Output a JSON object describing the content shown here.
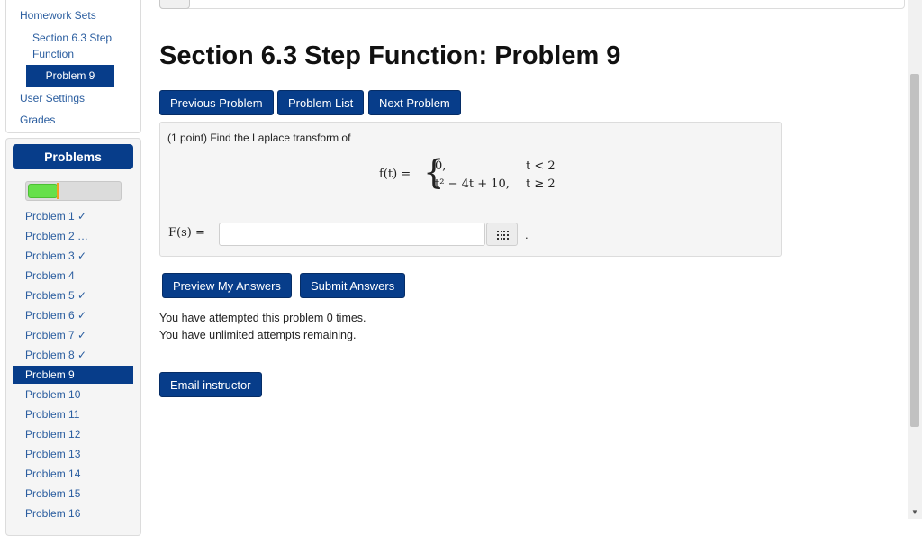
{
  "nav": {
    "homework_sets": "Homework Sets",
    "set_link_line1": "Section 6.3 Step",
    "set_link_line2": "Function",
    "current_problem": "Problem 9",
    "user_settings": "User Settings",
    "grades": "Grades"
  },
  "problems_panel": {
    "header": "Problems",
    "progress_fraction": 0.33,
    "items": [
      {
        "label": "Problem 1 ✓"
      },
      {
        "label": "Problem 2 …"
      },
      {
        "label": "Problem 3 ✓"
      },
      {
        "label": "Problem 4"
      },
      {
        "label": "Problem 5 ✓"
      },
      {
        "label": "Problem 6 ✓"
      },
      {
        "label": "Problem 7 ✓"
      },
      {
        "label": "Problem 8 ✓"
      },
      {
        "label": "Problem 9",
        "current": true
      },
      {
        "label": "Problem 10"
      },
      {
        "label": "Problem 11"
      },
      {
        "label": "Problem 12"
      },
      {
        "label": "Problem 13"
      },
      {
        "label": "Problem 14"
      },
      {
        "label": "Problem 15"
      },
      {
        "label": "Problem 16"
      }
    ]
  },
  "main": {
    "title": "Section 6.3 Step Function: Problem 9",
    "buttons": {
      "previous": "Previous Problem",
      "list": "Problem List",
      "next": "Next Problem"
    },
    "problem": {
      "prompt": "(1 point) Find the Laplace transform of",
      "lhs": "f(t) =",
      "case1_value": "0,",
      "case1_cond": "t < 2",
      "case2_value": "t² − 4t + 10,",
      "case2_cond": "t ≥ 2",
      "answer_label": "F(s) =",
      "answer_value": "",
      "trailing": "."
    },
    "actions": {
      "preview": "Preview My Answers",
      "submit": "Submit Answers"
    },
    "attempts_line1": "You have attempted this problem 0 times.",
    "attempts_line2": "You have unlimited attempts remaining.",
    "email": "Email instructor"
  },
  "icons": {
    "matrix_button": "grid-icon",
    "scroll_down": "chevron-down-icon"
  },
  "colors": {
    "primary": "#073d8a",
    "link": "#2a5d9f",
    "progress_green": "#66e04a"
  }
}
